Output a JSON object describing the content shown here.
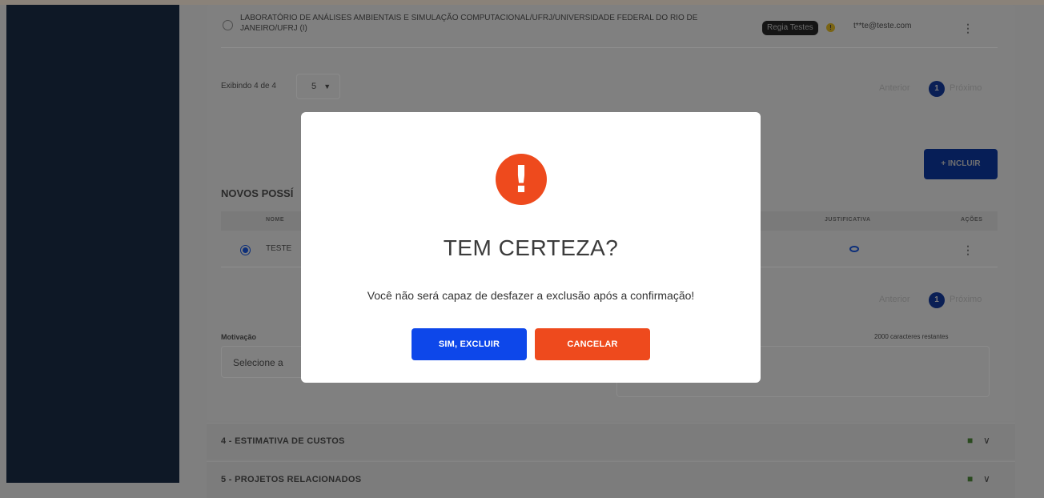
{
  "org_row": {
    "name": "LABORATÓRIO DE ANÁLISES AMBIENTAIS E SIMULAÇÃO COMPUTACIONAL/UFRJ/UNIVERSIDADE FEDERAL DO RIO DE JANEIRO/UFRJ (I)",
    "badge": "Regia Testes",
    "email": "t**te@teste.com",
    "menu_icon": "kebab-icon"
  },
  "pagination_top": {
    "showing": "Exibindo 4 de 4",
    "page_size": "5",
    "prev": "Anterior",
    "page": "1",
    "next": "Próximo"
  },
  "incluir_label": "+ INCLUIR",
  "section_title": "NOVOS POSSÍ",
  "table": {
    "headers": {
      "nome": "NOME",
      "justificativa": "JUSTIFICATIVA",
      "acoes": "AÇÕES"
    },
    "rows": [
      {
        "nome": "TESTE",
        "justificativa_icon": "eye-icon"
      }
    ]
  },
  "pagination_bottom": {
    "prev": "Anterior",
    "page": "1",
    "next": "Próximo"
  },
  "motivacao": {
    "label": "Motivação",
    "select_placeholder": "Selecione a",
    "remaining": "2000 caracteres restantes"
  },
  "accordions": [
    {
      "title": "4 - ESTIMATIVA DE CUSTOS"
    },
    {
      "title": "5 - PROJETOS RELACIONADOS"
    }
  ],
  "modal": {
    "icon": "warning-icon",
    "title": "TEM CERTEZA?",
    "message": "Você não será capaz de desfazer a exclusão após a confirmação!",
    "confirm": "SIM, EXCLUIR",
    "cancel": "CANCELAR"
  },
  "colors": {
    "confirm": "#0d47ea",
    "cancel": "#ee4a1d",
    "warning": "#ee4a1d",
    "sidebar": "#0e1826"
  }
}
